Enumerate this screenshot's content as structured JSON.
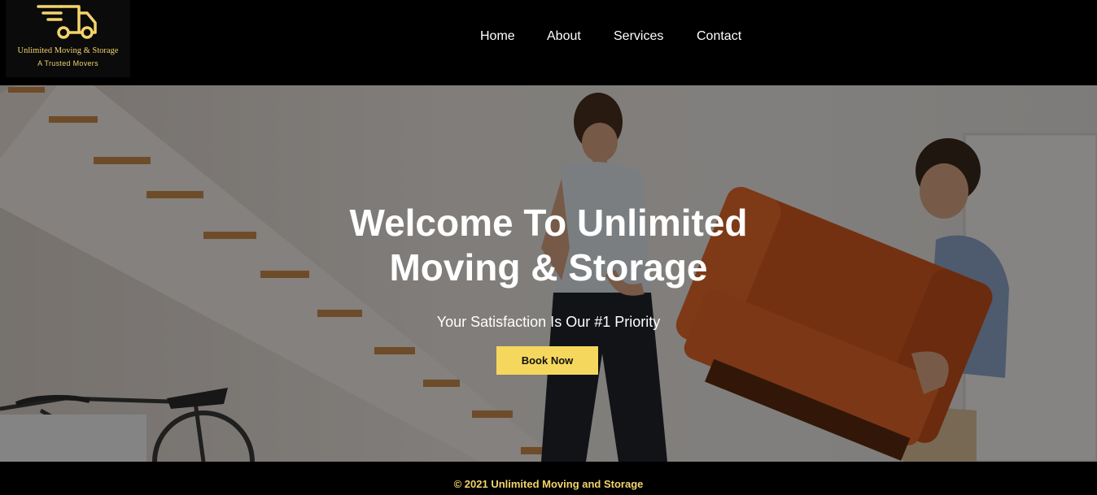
{
  "brand": {
    "name": "Unlimited Moving & Storage",
    "tagline": "A Trusted Movers",
    "accent": "#f3d36b",
    "logo_icon": "delivery-truck-icon"
  },
  "nav": {
    "items": [
      {
        "label": "Home"
      },
      {
        "label": "About"
      },
      {
        "label": "Services"
      },
      {
        "label": "Contact"
      }
    ]
  },
  "hero": {
    "title_line1": "Welcome To Unlimited",
    "title_line2": "Moving & Storage",
    "subtitle": "Your Satisfaction Is Our #1 Priority",
    "cta_label": "Book Now",
    "cta_color": "#f6d75e"
  },
  "footer": {
    "copyright": "© 2021 Unlimited Moving and Storage"
  }
}
